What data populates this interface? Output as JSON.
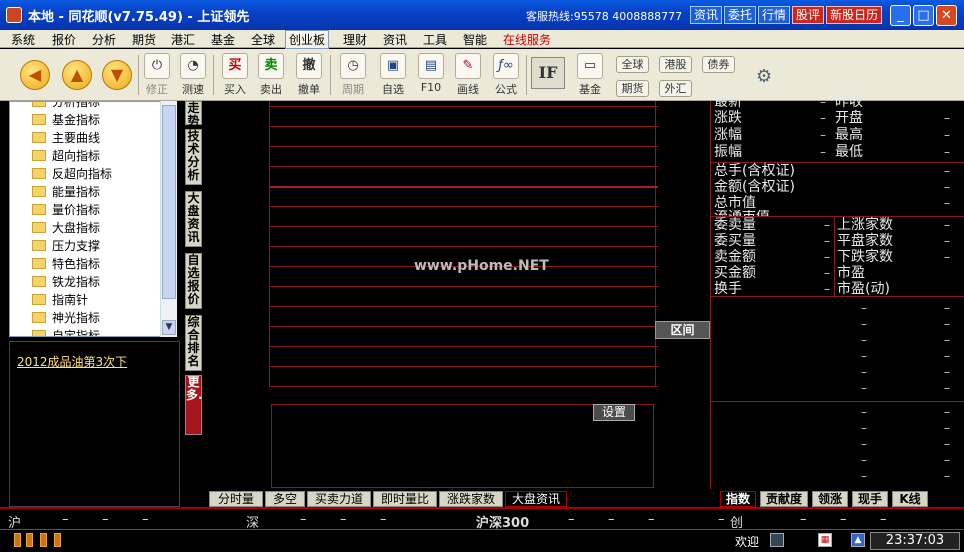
{
  "titlebar": {
    "title": "本地 - 同花顺(v7.75.49) - 上证领先",
    "hotline": "客服热线:95578 4008888777",
    "quick": [
      "资讯",
      "委托",
      "行情",
      "股评",
      "新股日历"
    ]
  },
  "menu": [
    "系统",
    "报价",
    "分析",
    "期货",
    "港汇",
    "基金",
    "全球",
    "创业板",
    "理财",
    "资讯",
    "工具",
    "智能",
    "在线服务"
  ],
  "toolbar": {
    "buttons": [
      {
        "label": "修正",
        "icon": "⏻"
      },
      {
        "label": "测速",
        "icon": "◔"
      },
      {
        "label": "买入",
        "icon": "买"
      },
      {
        "label": "卖出",
        "icon": "卖"
      },
      {
        "label": "撤单",
        "icon": "撤"
      },
      {
        "label": "周期",
        "icon": "◷"
      },
      {
        "label": "自选",
        "icon": "▣"
      },
      {
        "label": "F10",
        "icon": "▤"
      },
      {
        "label": "画线",
        "icon": "✎"
      },
      {
        "label": "公式",
        "icon": "ƒ∞"
      },
      {
        "label": "基金",
        "icon": "▭"
      }
    ],
    "if_label": "IF",
    "small": [
      "全球",
      "港股",
      "债券",
      "期货",
      "外汇"
    ]
  },
  "tree": {
    "items": [
      "分析指标",
      "基金指标",
      "主要曲线",
      "超向指标",
      "反超向指标",
      "能量指标",
      "量价指标",
      "大盘指标",
      "压力支撑",
      "特色指标",
      "铁龙指标",
      "指南针",
      "神光指标",
      "自定指标"
    ]
  },
  "news": {
    "headline": "2012成品油第3次下"
  },
  "vtabs": [
    "走势",
    "技术分析",
    "大盘资讯",
    "自选报价",
    "综合排名",
    "更多..."
  ],
  "chart": {
    "watermark": "www.pHome.NET",
    "range": "区间",
    "settings": "设置"
  },
  "btabs": [
    "分时量",
    "多空",
    "买卖力道",
    "即时量比",
    "涨跌家数",
    "大盘资讯"
  ],
  "rpanel": {
    "r1": [
      "最新",
      "涨跌",
      "涨幅",
      "振幅"
    ],
    "r1b": [
      "昨收",
      "开盘",
      "最高",
      "最低"
    ],
    "r2": [
      "总手(含权证)",
      "金额(含权证)",
      "总市值",
      "流通市值"
    ],
    "r3": [
      "委卖量",
      "委买量",
      "卖金额",
      "买金额",
      "换手"
    ],
    "r3b": [
      "上涨家数",
      "平盘家数",
      "下跌家数",
      "市盈",
      "市盈(动)"
    ]
  },
  "rtabs": [
    "指数",
    "贡献度",
    "领涨",
    "现手",
    "K线"
  ],
  "ticker": {
    "a": "沪",
    "b": "深",
    "c": "沪深300",
    "d": "创",
    "dash": "–"
  },
  "status": {
    "welcome": "欢迎",
    "clock": "23:37:03"
  }
}
